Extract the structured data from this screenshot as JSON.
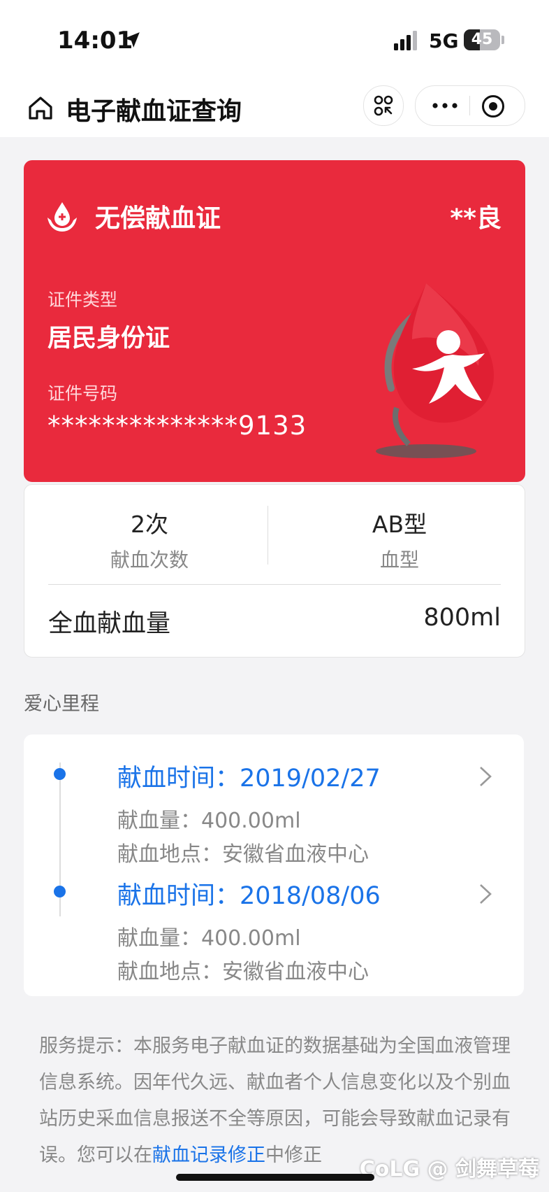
{
  "status_bar": {
    "time": "14:01",
    "network": "5G",
    "battery": "45",
    "battery_level_percent": 45
  },
  "navbar": {
    "title": "电子献血证查询"
  },
  "card": {
    "title": "无偿献血证",
    "holder_name": "**良",
    "id_type_label": "证件类型",
    "id_type_value": "居民身份证",
    "id_number_label": "证件号码",
    "id_number_value": "**************9133",
    "color": "#e92a3d"
  },
  "stats": {
    "donations_value": "2次",
    "donations_label": "献血次数",
    "blood_type_value": "AB型",
    "blood_type_label": "血型",
    "whole_blood_label": "全血献血量",
    "whole_blood_value": "800ml"
  },
  "journey": {
    "section_title": "爱心里程",
    "records": [
      {
        "date": "献血时间：2019/02/27",
        "amount": "献血量：400.00ml",
        "location": "献血地点：安徽省血液中心"
      },
      {
        "date": "献血时间：2018/08/06",
        "amount": "献血量：400.00ml",
        "location": "献血地点：安徽省血液中心"
      }
    ]
  },
  "notice": {
    "text_before_link": "服务提示：本服务电子献血证的数据基础为全国血液管理信息系统。因年代久远、献血者个人信息变化以及个别血站历史采血信息报送不全等原因，可能会导致献血记录有误。您可以在",
    "link_text": "献血记录修正",
    "text_after_link": "中修正"
  },
  "watermark": "CoLG @ 剑舞草莓",
  "colors": {
    "accent_blue": "#1a73e8",
    "card_red": "#e92a3d",
    "background": "#f3f3f5"
  }
}
